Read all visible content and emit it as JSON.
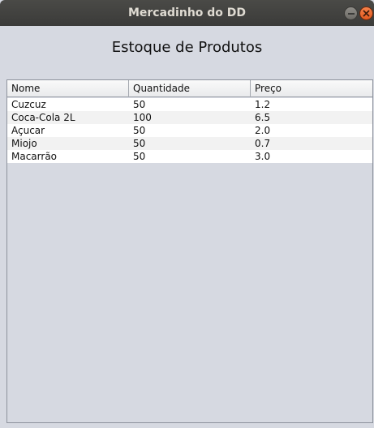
{
  "window": {
    "title": "Mercadinho do DD"
  },
  "main": {
    "heading": "Estoque de Produtos"
  },
  "table": {
    "columns": [
      "Nome",
      "Quantidade",
      "Preço"
    ],
    "rows": [
      [
        "Cuzcuz",
        "50",
        "1.2"
      ],
      [
        "Coca-Cola 2L",
        "100",
        "6.5"
      ],
      [
        "Açucar",
        "50",
        "2.0"
      ],
      [
        "Miojo",
        "50",
        "0.7"
      ],
      [
        "Macarrão",
        "50",
        "3.0"
      ]
    ]
  },
  "icons": {
    "minimize": "minimize-icon",
    "close": "close-icon"
  },
  "colors": {
    "titlebar": "#3f3f3c",
    "close_button": "#e95420",
    "window_background": "#d6d9e1"
  }
}
